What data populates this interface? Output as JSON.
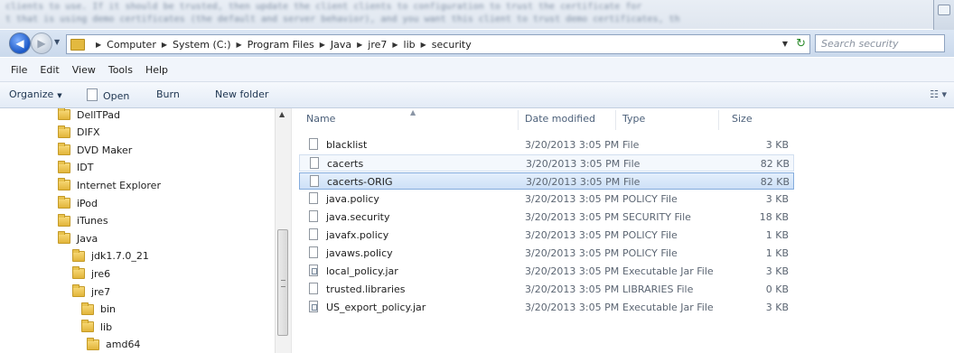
{
  "window": {
    "background_text": [
      "clients to use. If it should be trusted, then update the client clients to configuration to trust the certificate for",
      "t that is using demo certificates (the default and server behavior), and you want this client to trust demo certificates, th"
    ]
  },
  "address_bar": {
    "breadcrumbs": [
      "Computer",
      "System (C:)",
      "Program Files",
      "Java",
      "jre7",
      "lib",
      "security"
    ],
    "search_placeholder": "Search security"
  },
  "menu": [
    "File",
    "Edit",
    "View",
    "Tools",
    "Help"
  ],
  "toolbar": {
    "organize": "Organize",
    "open": "Open",
    "burn": "Burn",
    "new_folder": "New folder"
  },
  "tree": [
    {
      "label": "DellTPad",
      "level": 0
    },
    {
      "label": "DIFX",
      "level": 0
    },
    {
      "label": "DVD Maker",
      "level": 0
    },
    {
      "label": "IDT",
      "level": 0
    },
    {
      "label": "Internet Explorer",
      "level": 0
    },
    {
      "label": "iPod",
      "level": 0
    },
    {
      "label": "iTunes",
      "level": 0
    },
    {
      "label": "Java",
      "level": 0
    },
    {
      "label": "jdk1.7.0_21",
      "level": 1
    },
    {
      "label": "jre6",
      "level": 1
    },
    {
      "label": "jre7",
      "level": 1
    },
    {
      "label": "bin",
      "level": 2
    },
    {
      "label": "lib",
      "level": 2
    },
    {
      "label": "amd64",
      "level": 3
    }
  ],
  "columns": {
    "name": "Name",
    "date": "Date modified",
    "type": "Type",
    "size": "Size"
  },
  "files": [
    {
      "name": "blacklist",
      "date": "3/20/2013 3:05 PM",
      "type": "File",
      "size": "3 KB",
      "icon": "file-icon",
      "state": ""
    },
    {
      "name": "cacerts",
      "date": "3/20/2013 3:05 PM",
      "type": "File",
      "size": "82 KB",
      "icon": "file-icon",
      "state": "hover"
    },
    {
      "name": "cacerts-ORIG",
      "date": "3/20/2013 3:05 PM",
      "type": "File",
      "size": "82 KB",
      "icon": "file-icon",
      "state": "selected"
    },
    {
      "name": "java.policy",
      "date": "3/20/2013 3:05 PM",
      "type": "POLICY File",
      "size": "3 KB",
      "icon": "file-icon",
      "state": ""
    },
    {
      "name": "java.security",
      "date": "3/20/2013 3:05 PM",
      "type": "SECURITY File",
      "size": "18 KB",
      "icon": "file-icon",
      "state": ""
    },
    {
      "name": "javafx.policy",
      "date": "3/20/2013 3:05 PM",
      "type": "POLICY File",
      "size": "1 KB",
      "icon": "file-icon",
      "state": ""
    },
    {
      "name": "javaws.policy",
      "date": "3/20/2013 3:05 PM",
      "type": "POLICY File",
      "size": "1 KB",
      "icon": "file-icon",
      "state": ""
    },
    {
      "name": "local_policy.jar",
      "date": "3/20/2013 3:05 PM",
      "type": "Executable Jar File",
      "size": "3 KB",
      "icon": "jar-icon",
      "state": ""
    },
    {
      "name": "trusted.libraries",
      "date": "3/20/2013 3:05 PM",
      "type": "LIBRARIES File",
      "size": "0 KB",
      "icon": "file-icon",
      "state": ""
    },
    {
      "name": "US_export_policy.jar",
      "date": "3/20/2013 3:05 PM",
      "type": "Executable Jar File",
      "size": "3 KB",
      "icon": "jar-icon",
      "state": ""
    }
  ]
}
